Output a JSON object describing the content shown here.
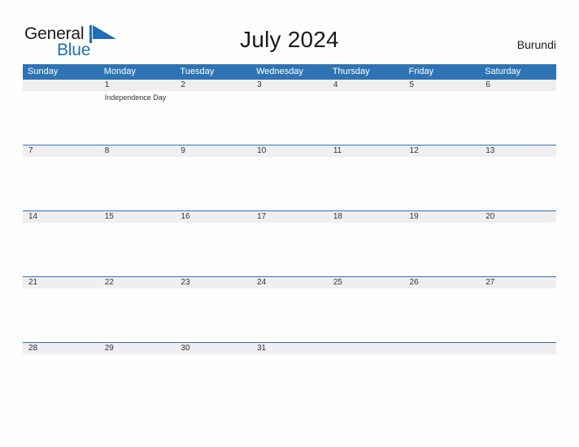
{
  "brand": {
    "name_part1": "General",
    "name_part2": "Blue",
    "flag_icon": "blue-triangle-flag-icon",
    "color_dark": "#1a1a1a",
    "color_blue": "#1F6FB5"
  },
  "header": {
    "title": "July 2024",
    "country": "Burundi"
  },
  "calendar": {
    "accent_color": "#2E74B5",
    "band_color": "#EFEFEF",
    "weekdays": [
      "Sunday",
      "Monday",
      "Tuesday",
      "Wednesday",
      "Thursday",
      "Friday",
      "Saturday"
    ],
    "weeks": [
      {
        "days": [
          {
            "number": "",
            "event": ""
          },
          {
            "number": "1",
            "event": "Independence Day"
          },
          {
            "number": "2",
            "event": ""
          },
          {
            "number": "3",
            "event": ""
          },
          {
            "number": "4",
            "event": ""
          },
          {
            "number": "5",
            "event": ""
          },
          {
            "number": "6",
            "event": ""
          }
        ]
      },
      {
        "days": [
          {
            "number": "7",
            "event": ""
          },
          {
            "number": "8",
            "event": ""
          },
          {
            "number": "9",
            "event": ""
          },
          {
            "number": "10",
            "event": ""
          },
          {
            "number": "11",
            "event": ""
          },
          {
            "number": "12",
            "event": ""
          },
          {
            "number": "13",
            "event": ""
          }
        ]
      },
      {
        "days": [
          {
            "number": "14",
            "event": ""
          },
          {
            "number": "15",
            "event": ""
          },
          {
            "number": "16",
            "event": ""
          },
          {
            "number": "17",
            "event": ""
          },
          {
            "number": "18",
            "event": ""
          },
          {
            "number": "19",
            "event": ""
          },
          {
            "number": "20",
            "event": ""
          }
        ]
      },
      {
        "days": [
          {
            "number": "21",
            "event": ""
          },
          {
            "number": "22",
            "event": ""
          },
          {
            "number": "23",
            "event": ""
          },
          {
            "number": "24",
            "event": ""
          },
          {
            "number": "25",
            "event": ""
          },
          {
            "number": "26",
            "event": ""
          },
          {
            "number": "27",
            "event": ""
          }
        ]
      },
      {
        "days": [
          {
            "number": "28",
            "event": ""
          },
          {
            "number": "29",
            "event": ""
          },
          {
            "number": "30",
            "event": ""
          },
          {
            "number": "31",
            "event": ""
          },
          {
            "number": "",
            "event": ""
          },
          {
            "number": "",
            "event": ""
          },
          {
            "number": "",
            "event": ""
          }
        ]
      }
    ]
  }
}
